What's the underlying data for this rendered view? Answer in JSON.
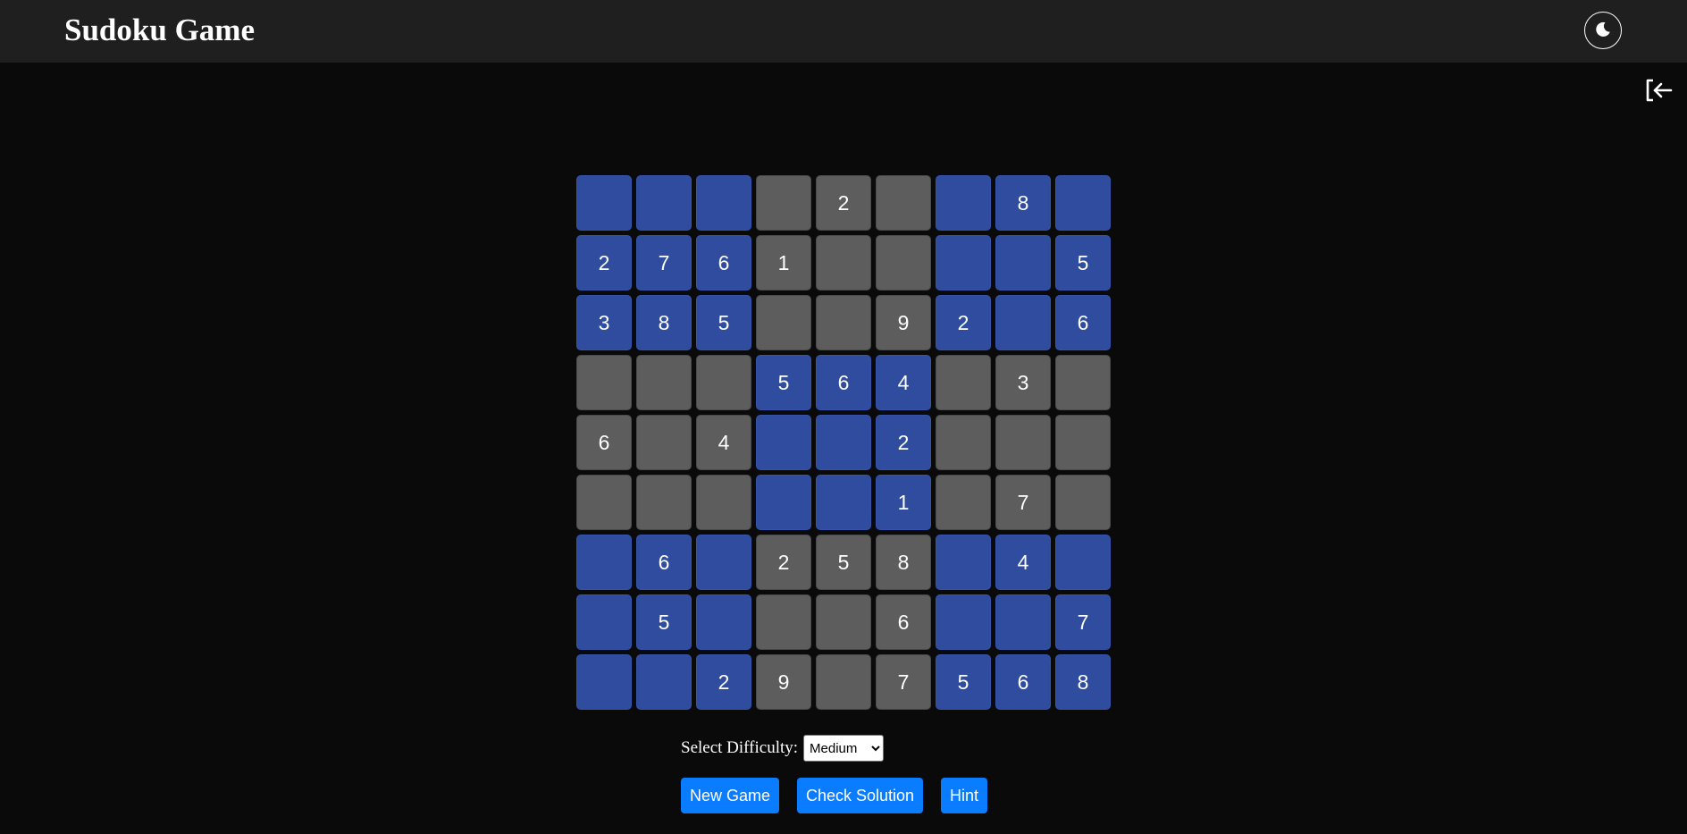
{
  "header": {
    "title": "Sudoku Game",
    "theme_icon": "moon-icon",
    "sidebar_icon": "sidebar-collapse-icon"
  },
  "colors": {
    "header_bg": "#1f1f1f",
    "page_bg": "#0a0a0a",
    "cell_blue": "#2f4c9e",
    "cell_gray": "#5e5d5d",
    "button_blue": "#0a7cff"
  },
  "board": {
    "rows": [
      [
        {
          "v": "",
          "c": "blue"
        },
        {
          "v": "",
          "c": "blue"
        },
        {
          "v": "",
          "c": "blue"
        },
        {
          "v": "",
          "c": "gray"
        },
        {
          "v": "2",
          "c": "gray"
        },
        {
          "v": "",
          "c": "gray"
        },
        {
          "v": "",
          "c": "blue"
        },
        {
          "v": "8",
          "c": "blue"
        },
        {
          "v": "",
          "c": "blue"
        }
      ],
      [
        {
          "v": "2",
          "c": "blue"
        },
        {
          "v": "7",
          "c": "blue"
        },
        {
          "v": "6",
          "c": "blue"
        },
        {
          "v": "1",
          "c": "gray"
        },
        {
          "v": "",
          "c": "gray"
        },
        {
          "v": "",
          "c": "gray"
        },
        {
          "v": "",
          "c": "blue"
        },
        {
          "v": "",
          "c": "blue"
        },
        {
          "v": "5",
          "c": "blue"
        }
      ],
      [
        {
          "v": "3",
          "c": "blue"
        },
        {
          "v": "8",
          "c": "blue"
        },
        {
          "v": "5",
          "c": "blue"
        },
        {
          "v": "",
          "c": "gray"
        },
        {
          "v": "",
          "c": "gray"
        },
        {
          "v": "9",
          "c": "gray"
        },
        {
          "v": "2",
          "c": "blue"
        },
        {
          "v": "",
          "c": "blue"
        },
        {
          "v": "6",
          "c": "blue"
        }
      ],
      [
        {
          "v": "",
          "c": "gray"
        },
        {
          "v": "",
          "c": "gray"
        },
        {
          "v": "",
          "c": "gray"
        },
        {
          "v": "5",
          "c": "blue"
        },
        {
          "v": "6",
          "c": "blue"
        },
        {
          "v": "4",
          "c": "blue"
        },
        {
          "v": "",
          "c": "gray"
        },
        {
          "v": "3",
          "c": "gray"
        },
        {
          "v": "",
          "c": "gray"
        }
      ],
      [
        {
          "v": "6",
          "c": "gray"
        },
        {
          "v": "",
          "c": "gray"
        },
        {
          "v": "4",
          "c": "gray"
        },
        {
          "v": "",
          "c": "blue"
        },
        {
          "v": "",
          "c": "blue"
        },
        {
          "v": "2",
          "c": "blue"
        },
        {
          "v": "",
          "c": "gray"
        },
        {
          "v": "",
          "c": "gray"
        },
        {
          "v": "",
          "c": "gray"
        }
      ],
      [
        {
          "v": "",
          "c": "gray"
        },
        {
          "v": "",
          "c": "gray"
        },
        {
          "v": "",
          "c": "gray"
        },
        {
          "v": "",
          "c": "blue"
        },
        {
          "v": "",
          "c": "blue"
        },
        {
          "v": "1",
          "c": "blue"
        },
        {
          "v": "",
          "c": "gray"
        },
        {
          "v": "7",
          "c": "gray"
        },
        {
          "v": "",
          "c": "gray"
        }
      ],
      [
        {
          "v": "",
          "c": "blue"
        },
        {
          "v": "6",
          "c": "blue"
        },
        {
          "v": "",
          "c": "blue"
        },
        {
          "v": "2",
          "c": "gray"
        },
        {
          "v": "5",
          "c": "gray"
        },
        {
          "v": "8",
          "c": "gray"
        },
        {
          "v": "",
          "c": "blue"
        },
        {
          "v": "4",
          "c": "blue"
        },
        {
          "v": "",
          "c": "blue"
        }
      ],
      [
        {
          "v": "",
          "c": "blue"
        },
        {
          "v": "5",
          "c": "blue"
        },
        {
          "v": "",
          "c": "blue"
        },
        {
          "v": "",
          "c": "gray"
        },
        {
          "v": "",
          "c": "gray"
        },
        {
          "v": "6",
          "c": "gray"
        },
        {
          "v": "",
          "c": "blue"
        },
        {
          "v": "",
          "c": "blue"
        },
        {
          "v": "7",
          "c": "blue"
        }
      ],
      [
        {
          "v": "",
          "c": "blue"
        },
        {
          "v": "",
          "c": "blue"
        },
        {
          "v": "2",
          "c": "blue"
        },
        {
          "v": "9",
          "c": "gray"
        },
        {
          "v": "",
          "c": "gray"
        },
        {
          "v": "7",
          "c": "gray"
        },
        {
          "v": "5",
          "c": "blue"
        },
        {
          "v": "6",
          "c": "blue"
        },
        {
          "v": "8",
          "c": "blue"
        }
      ]
    ]
  },
  "controls": {
    "difficulty_label": "Select Difficulty:",
    "difficulty_selected": "Medium",
    "new_game_label": "New Game",
    "check_solution_label": "Check Solution",
    "hint_label": "Hint"
  }
}
